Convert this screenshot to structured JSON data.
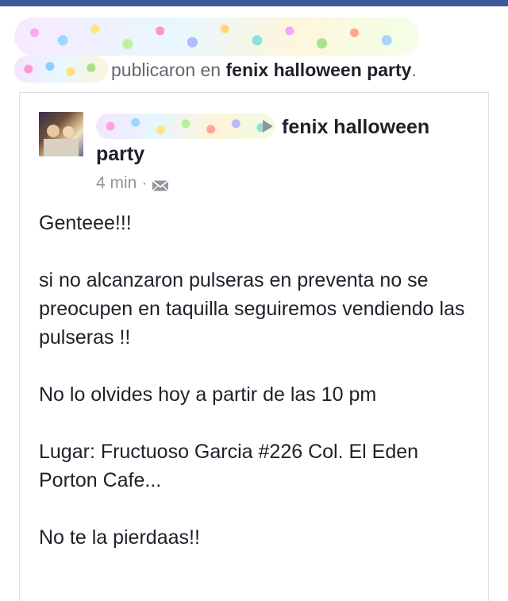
{
  "story": {
    "action_text": "publicaron en ",
    "group_link": "fenix halloween party",
    "period": "."
  },
  "post": {
    "group_name": "fenix halloween party",
    "timestamp": "4 min",
    "separator": "·",
    "audience_icon": "envelope-icon",
    "paragraphs": [
      "Genteee!!!",
      "si no alcanzaron pulseras en preventa no se preocupen en taquilla seguiremos vendiendo las pulseras !!",
      "No lo olvides hoy a partir de las 10 pm",
      "Lugar: Fructuoso Garcia #226 Col. El Eden\nPorton Cafe...",
      "No te la pierdaas!!"
    ]
  },
  "colors": {
    "brand_bar": "#3b5998",
    "text_primary": "#1d2129",
    "text_secondary": "#616770",
    "meta_gray": "#90949c",
    "card_border": "#dddfe2"
  }
}
